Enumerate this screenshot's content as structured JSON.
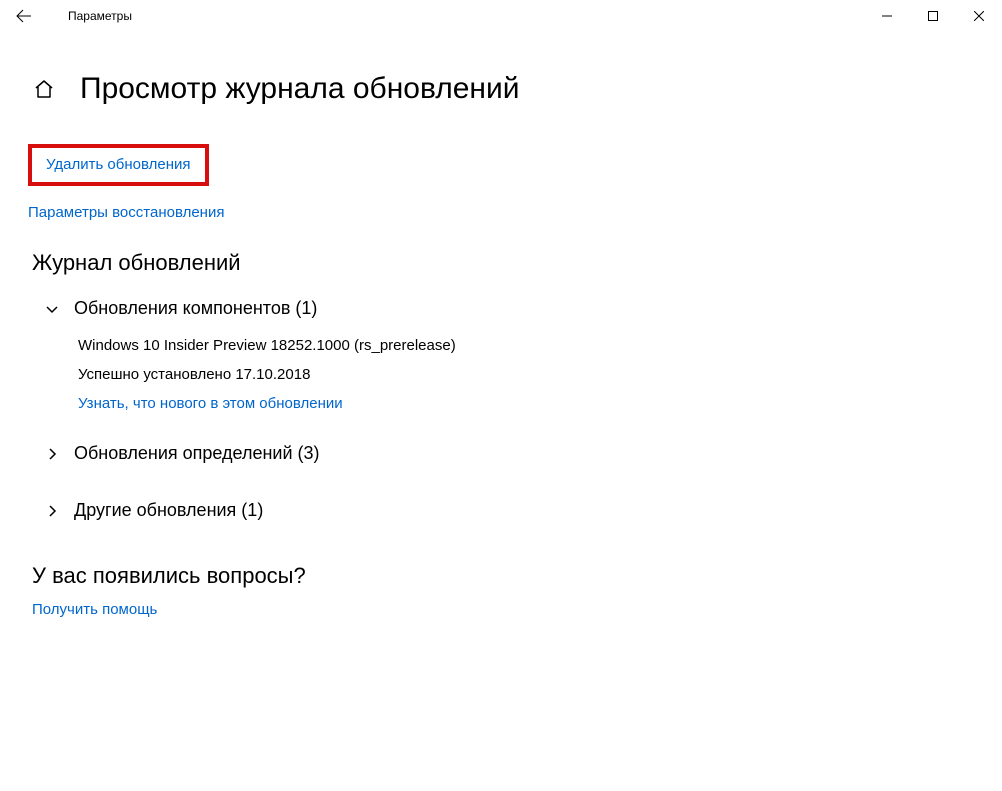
{
  "titlebar": {
    "title": "Параметры"
  },
  "page": {
    "title": "Просмотр журнала обновлений"
  },
  "links": {
    "uninstall_updates": "Удалить обновления",
    "recovery_options": "Параметры восстановления"
  },
  "history": {
    "section_title": "Журнал обновлений",
    "feature_updates": {
      "label": "Обновления компонентов (1)",
      "item_name": "Windows 10 Insider Preview 18252.1000 (rs_prerelease)",
      "item_status": "Успешно установлено 17.10.2018",
      "whats_new": "Узнать, что нового в этом обновлении"
    },
    "definition_updates": {
      "label": "Обновления определений (3)"
    },
    "other_updates": {
      "label": "Другие обновления (1)"
    }
  },
  "help": {
    "question_title": "У вас появились вопросы?",
    "get_help": "Получить помощь"
  }
}
